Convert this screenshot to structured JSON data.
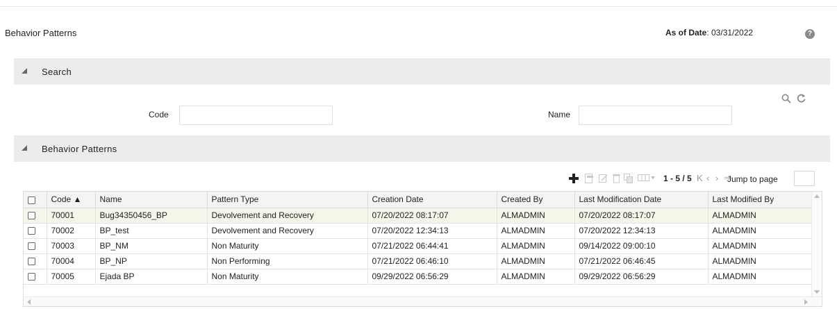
{
  "header": {
    "title": "Behavior Patterns",
    "as_of_label": "As of Date",
    "as_of_value": ": 03/31/2022",
    "help_icon": "help-icon"
  },
  "search_section": {
    "label": "Search",
    "code_label": "Code",
    "code_value": "",
    "name_label": "Name",
    "name_value": "",
    "search_icon": "search-icon",
    "reset_icon": "refresh-icon"
  },
  "list_section": {
    "label": "Behavior Patterns",
    "toolbar_icons": [
      "add-icon",
      "view-icon",
      "edit-icon",
      "delete-icon",
      "copy-icon",
      "column-chooser-icon"
    ],
    "pager": {
      "range": "1 - 5 / 5",
      "jump_label": "Jump to page",
      "jump_value": ""
    },
    "columns": [
      "Code ▲",
      "Name",
      "Pattern Type",
      "Creation Date",
      "Created By",
      "Last Modification Date",
      "Last Modified By"
    ],
    "rows": [
      {
        "code": "70001",
        "name": "Bug34350456_BP",
        "type": "Devolvement and Recovery",
        "created": "07/20/2022 08:17:07",
        "created_by": "ALMADMIN",
        "modified": "07/20/2022 08:17:07",
        "modified_by": "ALMADMIN"
      },
      {
        "code": "70002",
        "name": "BP_test",
        "type": "Devolvement and Recovery",
        "created": "07/20/2022 12:34:13",
        "created_by": "ALMADMIN",
        "modified": "07/20/2022 12:34:13",
        "modified_by": "ALMADMIN"
      },
      {
        "code": "70003",
        "name": "BP_NM",
        "type": "Non Maturity",
        "created": "07/21/2022 06:44:41",
        "created_by": "ALMADMIN",
        "modified": "09/14/2022 09:00:10",
        "modified_by": "ALMADMIN"
      },
      {
        "code": "70004",
        "name": "BP_NP",
        "type": "Non Performing",
        "created": "07/21/2022 06:46:10",
        "created_by": "ALMADMIN",
        "modified": "07/21/2022 06:46:45",
        "modified_by": "ALMADMIN"
      },
      {
        "code": "70005",
        "name": "Ejada BP",
        "type": "Non Maturity",
        "created": "09/29/2022 06:56:29",
        "created_by": "ALMADMIN",
        "modified": "09/29/2022 06:56:29",
        "modified_by": "ALMADMIN"
      }
    ]
  },
  "colors": {
    "section_bar": "#ececec",
    "selected_row": "#f3f6e8",
    "icon_gray": "#8a8a8a"
  }
}
